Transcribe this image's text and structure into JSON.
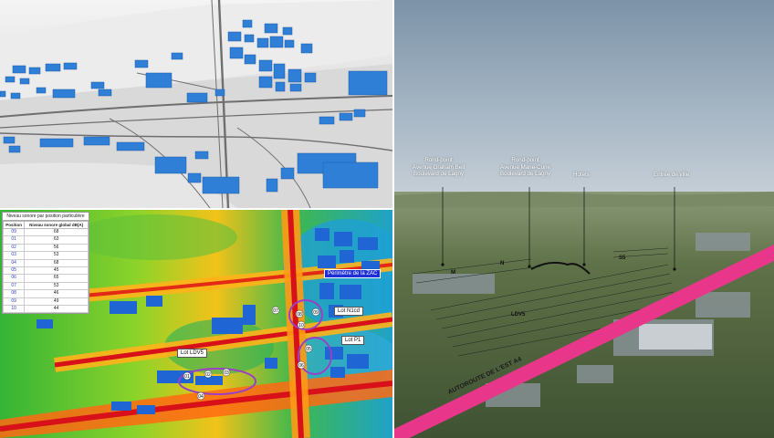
{
  "noise_table": {
    "title": "Niveau sonore par position particulière",
    "col_position": "Position",
    "col_level": "Niveau sonore global dB(A)",
    "rows": [
      {
        "position": "09",
        "level": "68"
      },
      {
        "position": "01",
        "level": "63"
      },
      {
        "position": "02",
        "level": "56"
      },
      {
        "position": "03",
        "level": "53"
      },
      {
        "position": "04",
        "level": "68"
      },
      {
        "position": "05",
        "level": "45"
      },
      {
        "position": "06",
        "level": "65"
      },
      {
        "position": "07",
        "level": "53"
      },
      {
        "position": "08",
        "level": "46"
      },
      {
        "position": "09",
        "level": "49"
      },
      {
        "position": "10",
        "level": "44"
      }
    ]
  },
  "noise_map_labels": {
    "perimetre": "Périmètre de la ZAC",
    "lot_n1cd": "Lot N1cd",
    "lot_p1": "Lot P1",
    "lot_ldv5": "Lot LDV5",
    "points": [
      "01",
      "02",
      "03",
      "04",
      "05",
      "06",
      "07",
      "08",
      "09",
      "10"
    ]
  },
  "aerial": {
    "poi_1": "Rond-point\nAvenue Graham Bell\nBoulevard de Lagny",
    "poi_2": "Rond-point\nAvenue Marie-Curie\nBoulevard de Lagny",
    "poi_3": "Hotels",
    "poi_4": "Entrée de ville",
    "lot_m": "M",
    "lot_n": "N",
    "lot_s5": "S5",
    "lot_ldv5": "LDV5",
    "highway": "AUTOROUTE DE L'EST A4"
  },
  "colors": {
    "building_blue": "#2f7fd6",
    "highway_pink": "#e8378a",
    "label_blue": "#1f2fd6",
    "zone_purple": "#9b3fc8"
  }
}
